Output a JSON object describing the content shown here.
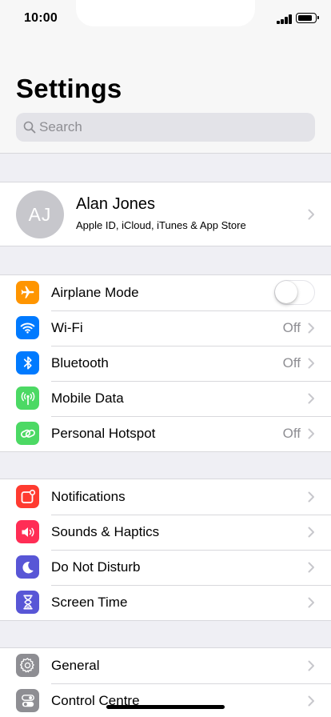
{
  "status": {
    "time": "10:00"
  },
  "header": {
    "title": "Settings",
    "search_placeholder": "Search"
  },
  "profile": {
    "initials": "AJ",
    "name": "Alan Jones",
    "subtitle": "Apple ID, iCloud, iTunes & App Store"
  },
  "groups": [
    {
      "rows": [
        {
          "label": "Airplane Mode",
          "icon": "airplane-icon",
          "color": "#ff9500",
          "toggle": false
        },
        {
          "label": "Wi-Fi",
          "icon": "wifi-icon",
          "color": "#007aff",
          "value": "Off"
        },
        {
          "label": "Bluetooth",
          "icon": "bluetooth-icon",
          "color": "#007aff",
          "value": "Off"
        },
        {
          "label": "Mobile Data",
          "icon": "antenna-icon",
          "color": "#4cd964"
        },
        {
          "label": "Personal Hotspot",
          "icon": "hotspot-icon",
          "color": "#4cd964",
          "value": "Off"
        }
      ]
    },
    {
      "rows": [
        {
          "label": "Notifications",
          "icon": "notifications-icon",
          "color": "#ff3b30"
        },
        {
          "label": "Sounds & Haptics",
          "icon": "speaker-icon",
          "color": "#ff2d55"
        },
        {
          "label": "Do Not Disturb",
          "icon": "moon-icon",
          "color": "#5856d6"
        },
        {
          "label": "Screen Time",
          "icon": "hourglass-icon",
          "color": "#5856d6"
        }
      ]
    },
    {
      "rows": [
        {
          "label": "General",
          "icon": "gear-icon",
          "color": "#8e8e93"
        },
        {
          "label": "Control Centre",
          "icon": "switches-icon",
          "color": "#8e8e93"
        }
      ]
    }
  ]
}
